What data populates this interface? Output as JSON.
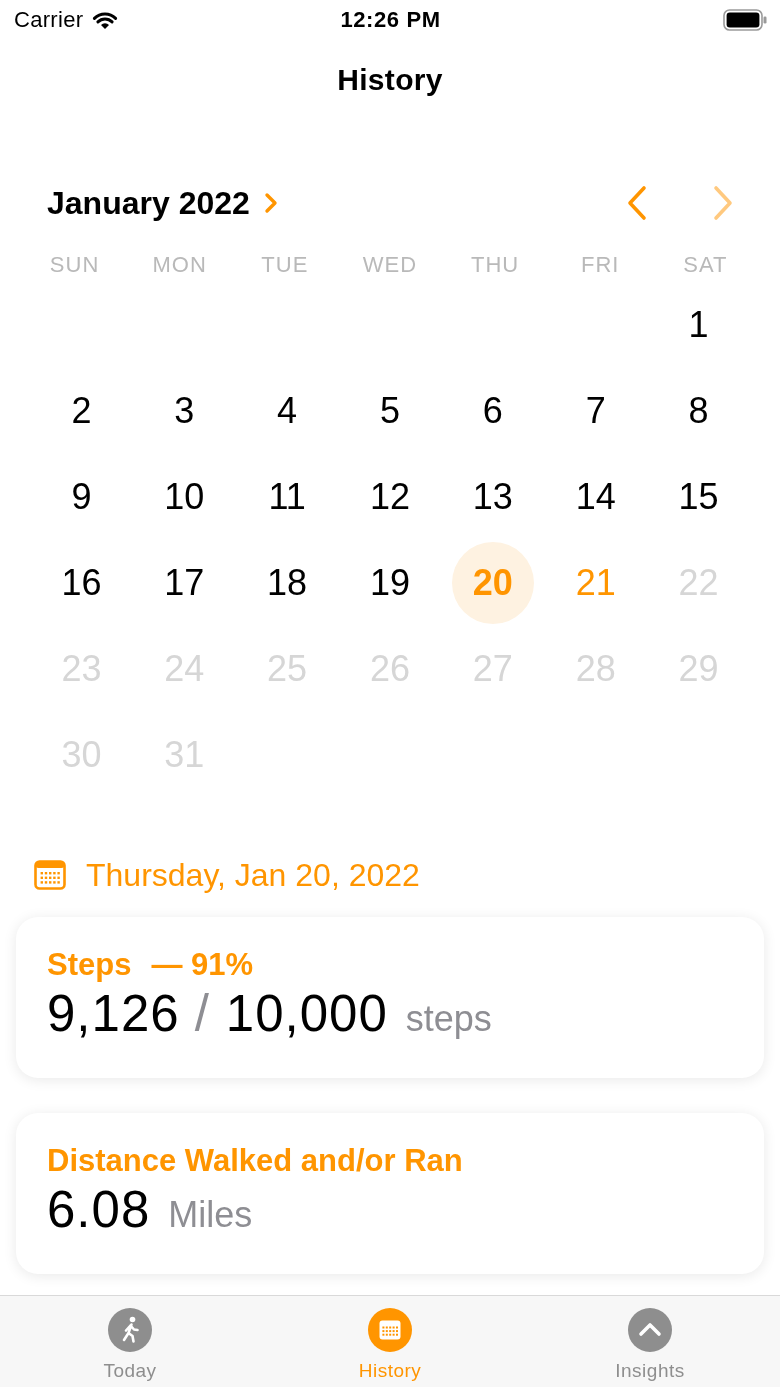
{
  "status_bar": {
    "carrier": "Carrier",
    "time": "12:26 PM"
  },
  "nav": {
    "title": "History"
  },
  "calendar": {
    "month": "January 2022",
    "previous": {
      "disabled": false
    },
    "next": {
      "disabled": true
    },
    "weekdays": [
      "SUN",
      "MON",
      "TUE",
      "WED",
      "THU",
      "FRI",
      "SAT"
    ],
    "weeks": [
      {
        "kind": "first",
        "days": [
          {
            "label": "1",
            "selected": false,
            "today": false,
            "disabled": false
          }
        ]
      },
      {
        "kind": "full",
        "days": [
          {
            "label": "2",
            "selected": false,
            "today": false,
            "disabled": false
          },
          {
            "label": "3",
            "selected": false,
            "today": false,
            "disabled": false
          },
          {
            "label": "4",
            "selected": false,
            "today": false,
            "disabled": false
          },
          {
            "label": "5",
            "selected": false,
            "today": false,
            "disabled": false
          },
          {
            "label": "6",
            "selected": false,
            "today": false,
            "disabled": false
          },
          {
            "label": "7",
            "selected": false,
            "today": false,
            "disabled": false
          },
          {
            "label": "8",
            "selected": false,
            "today": false,
            "disabled": false
          }
        ]
      },
      {
        "kind": "full",
        "days": [
          {
            "label": "9",
            "selected": false,
            "today": false,
            "disabled": false
          },
          {
            "label": "10",
            "selected": false,
            "today": false,
            "disabled": false
          },
          {
            "label": "11",
            "selected": false,
            "today": false,
            "disabled": false
          },
          {
            "label": "12",
            "selected": false,
            "today": false,
            "disabled": false
          },
          {
            "label": "13",
            "selected": false,
            "today": false,
            "disabled": false
          },
          {
            "label": "14",
            "selected": false,
            "today": false,
            "disabled": false
          },
          {
            "label": "15",
            "selected": false,
            "today": false,
            "disabled": false
          }
        ]
      },
      {
        "kind": "full",
        "days": [
          {
            "label": "16",
            "selected": false,
            "today": false,
            "disabled": false
          },
          {
            "label": "17",
            "selected": false,
            "today": false,
            "disabled": false
          },
          {
            "label": "18",
            "selected": false,
            "today": false,
            "disabled": false
          },
          {
            "label": "19",
            "selected": false,
            "today": false,
            "disabled": false
          },
          {
            "label": "20",
            "selected": true,
            "today": false,
            "disabled": false
          },
          {
            "label": "21",
            "selected": false,
            "today": true,
            "disabled": false
          },
          {
            "label": "22",
            "selected": false,
            "today": false,
            "disabled": true
          }
        ]
      },
      {
        "kind": "full",
        "days": [
          {
            "label": "23",
            "selected": false,
            "today": false,
            "disabled": true
          },
          {
            "label": "24",
            "selected": false,
            "today": false,
            "disabled": true
          },
          {
            "label": "25",
            "selected": false,
            "today": false,
            "disabled": true
          },
          {
            "label": "26",
            "selected": false,
            "today": false,
            "disabled": true
          },
          {
            "label": "27",
            "selected": false,
            "today": false,
            "disabled": true
          },
          {
            "label": "28",
            "selected": false,
            "today": false,
            "disabled": true
          },
          {
            "label": "29",
            "selected": false,
            "today": false,
            "disabled": true
          }
        ]
      },
      {
        "kind": "last",
        "days": [
          {
            "label": "30",
            "selected": false,
            "today": false,
            "disabled": true
          },
          {
            "label": "31",
            "selected": false,
            "today": false,
            "disabled": true
          }
        ]
      }
    ]
  },
  "selected_date": {
    "label": "Thursday, Jan 20, 2022"
  },
  "cards": [
    {
      "title": "Steps",
      "note": "— 91%",
      "value": "9,126",
      "separator": "/",
      "goal": "10,000",
      "unit": "steps"
    },
    {
      "title": "Distance Walked and/or Ran",
      "value": "6.08",
      "unit": "Miles"
    }
  ],
  "tab_bar": {
    "tabs": [
      {
        "label": "Today",
        "selected": false
      },
      {
        "label": "History",
        "selected": true
      },
      {
        "label": "Insights",
        "selected": false
      }
    ]
  }
}
